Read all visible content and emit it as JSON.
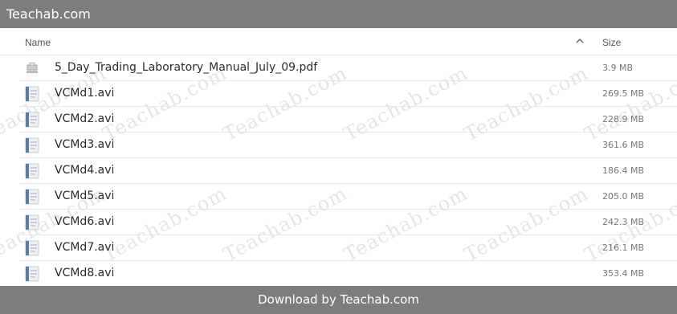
{
  "title": "Teachab.com",
  "header": {
    "name_label": "Name",
    "size_label": "Size"
  },
  "watermark_text": "Teachab.com",
  "files": [
    {
      "name": "5_Day_Trading_Laboratory_Manual_July_09.pdf",
      "size": "3.9 MB",
      "icon": "pdf-thumbnail-icon"
    },
    {
      "name": "VCMd1.avi",
      "size": "269.5 MB",
      "icon": "video-thumbnail-icon"
    },
    {
      "name": "VCMd2.avi",
      "size": "228.9 MB",
      "icon": "video-thumbnail-icon"
    },
    {
      "name": "VCMd3.avi",
      "size": "361.6 MB",
      "icon": "video-thumbnail-icon"
    },
    {
      "name": "VCMd4.avi",
      "size": "186.4 MB",
      "icon": "video-thumbnail-icon"
    },
    {
      "name": "VCMd5.avi",
      "size": "205.0 MB",
      "icon": "video-thumbnail-icon"
    },
    {
      "name": "VCMd6.avi",
      "size": "242.3 MB",
      "icon": "video-thumbnail-icon"
    },
    {
      "name": "VCMd7.avi",
      "size": "216.1 MB",
      "icon": "video-thumbnail-icon"
    },
    {
      "name": "VCMd8.avi",
      "size": "353.4 MB",
      "icon": "video-thumbnail-icon"
    }
  ],
  "footer_text": "Download by Teachab.com",
  "colors": {
    "bar": "#7d7d7d",
    "divider": "#e8e8e8"
  }
}
